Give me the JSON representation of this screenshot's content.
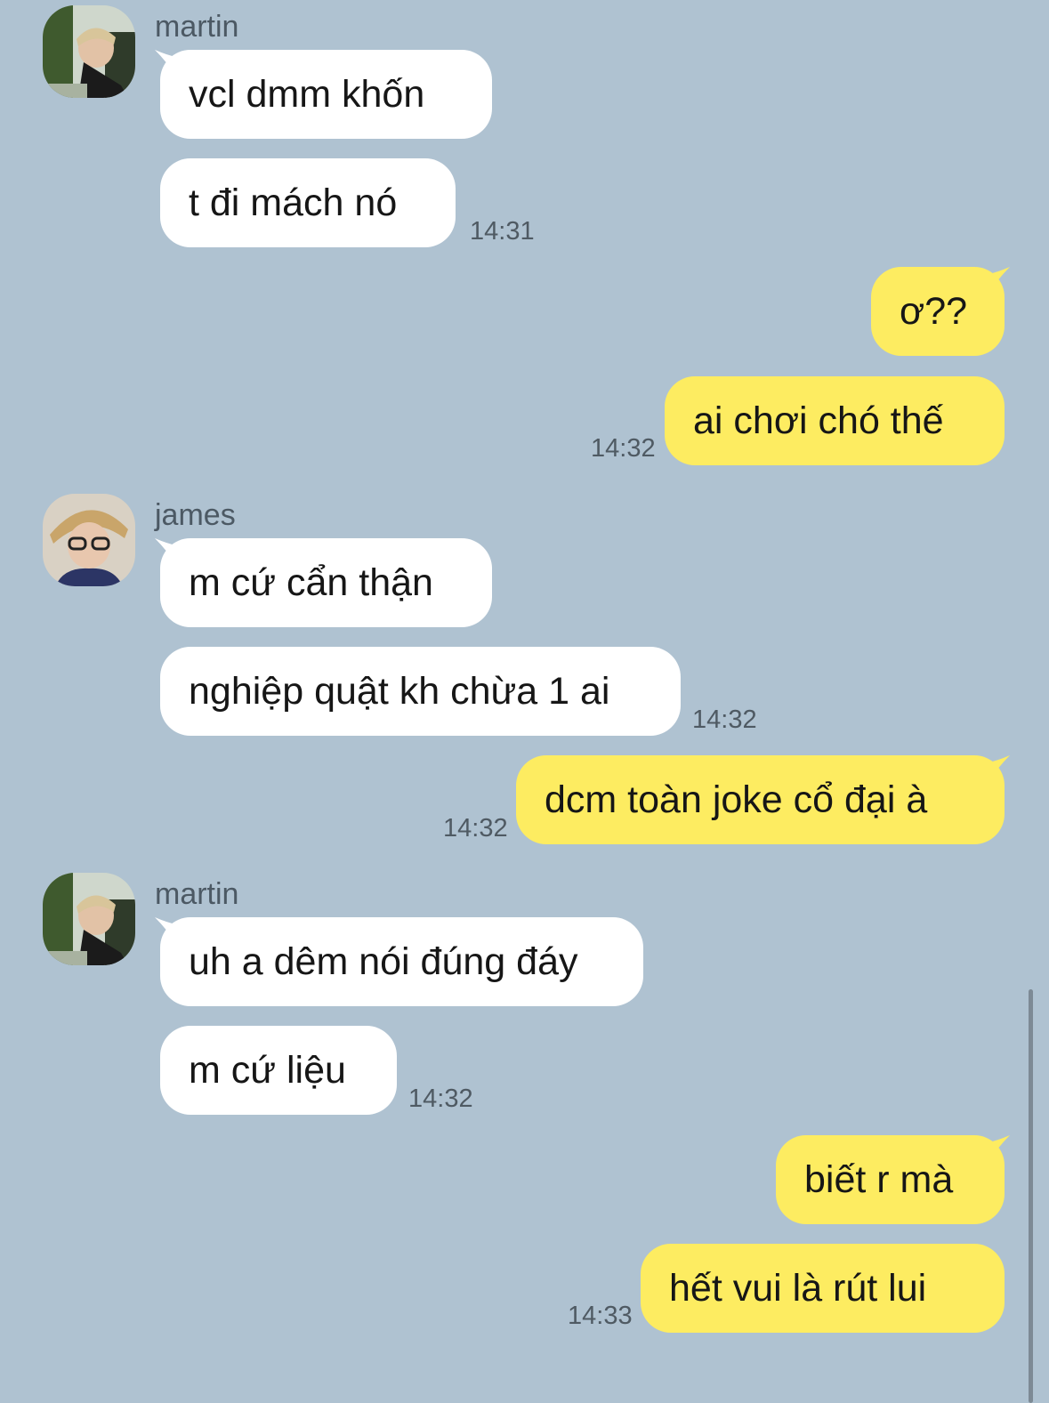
{
  "messages": [
    {
      "sender": "martin",
      "text": "vcl dmm khốn"
    },
    {
      "text": "t đi mách nó",
      "time": "14:31"
    },
    {
      "text": "ơ??"
    },
    {
      "text": "ai chơi chó thế",
      "time": "14:32"
    },
    {
      "sender": "james",
      "text": "m cứ cẩn thận"
    },
    {
      "text": "nghiệp quật kh chừa 1 ai",
      "time": "14:32"
    },
    {
      "text": "dcm toàn joke cổ đại à",
      "time": "14:32"
    },
    {
      "sender": "martin",
      "text": "uh a dêm nói đúng đáy"
    },
    {
      "text": "m cứ liệu",
      "time": "14:32"
    },
    {
      "text": "biết r mà"
    },
    {
      "text": "hết vui là rút lui",
      "time": "14:33"
    }
  ],
  "colors": {
    "background": "#afc2d1",
    "incoming_bubble": "#ffffff",
    "outgoing_bubble": "#fdec61"
  }
}
